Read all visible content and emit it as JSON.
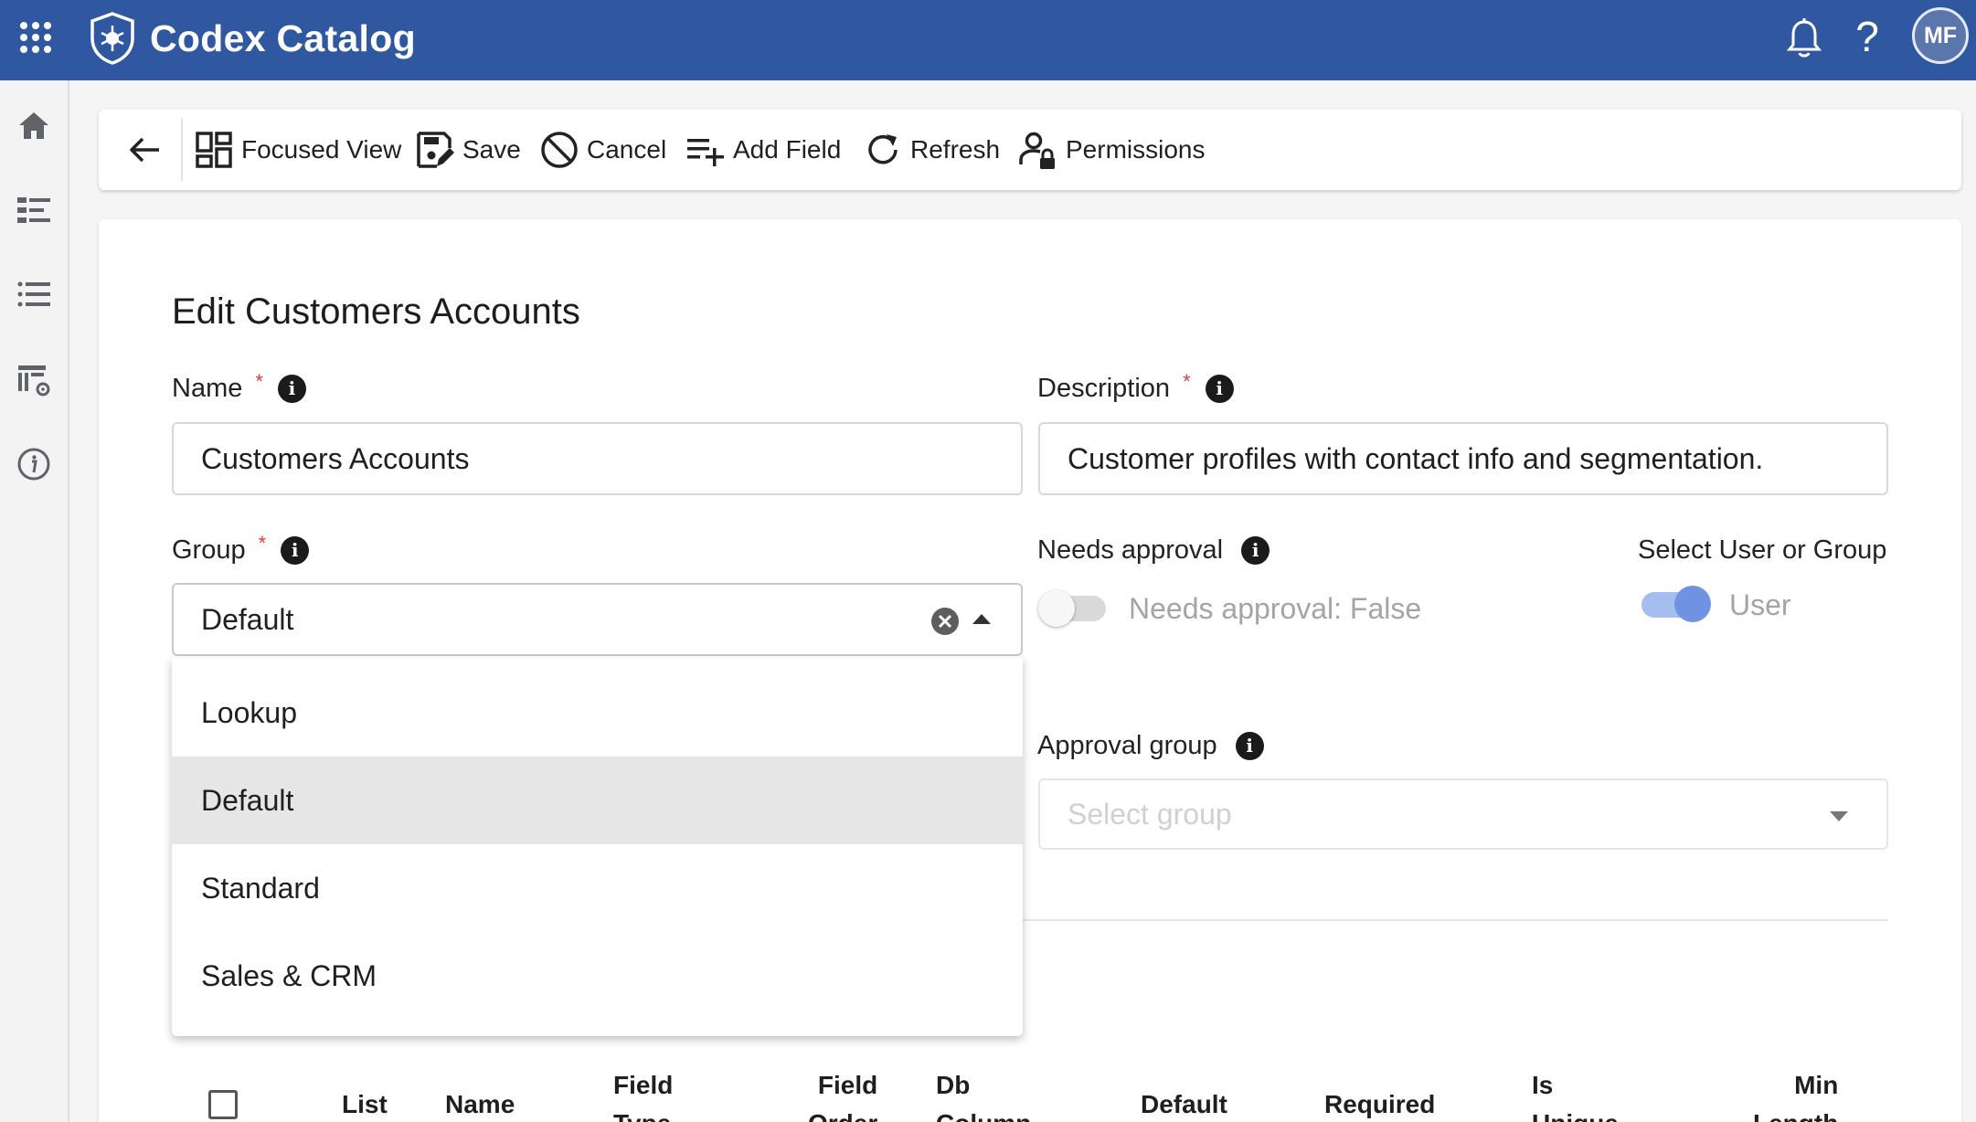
{
  "app": {
    "title": "Codex Catalog",
    "user_initials": "MF",
    "help_label": "?"
  },
  "toolbar": {
    "focused_view": "Focused View",
    "save": "Save",
    "cancel": "Cancel",
    "add_field": "Add Field",
    "refresh": "Refresh",
    "permissions": "Permissions"
  },
  "form": {
    "title": "Edit Customers Accounts",
    "name_label": "Name",
    "name_value": "Customers Accounts",
    "description_label": "Description",
    "description_value": "Customer profiles with contact info and segmentation.",
    "group_label": "Group",
    "group_value": "Default",
    "group_options": [
      "Lookup",
      "Default",
      "Standard",
      "Sales & CRM"
    ],
    "needs_approval_label": "Needs approval",
    "needs_approval_text": "Needs approval: False",
    "select_user_group_label": "Select User or Group",
    "select_user_group_value": "User",
    "approval_group_label": "Approval group",
    "approval_group_placeholder": "Select group",
    "required_mark": "*",
    "info_glyph": "i"
  },
  "table": {
    "headers": {
      "list": "List",
      "name": "Name",
      "field_type_1": "Field",
      "field_type_2": "Type",
      "field_order_1": "Field",
      "field_order_2": "Order",
      "db_column_1": "Db",
      "db_column_2": "Column",
      "default": "Default",
      "required": "Required",
      "is_unique_1": "Is",
      "is_unique_2": "Unique",
      "min_length_1": "Min",
      "min_length_2": "Length"
    }
  },
  "colors": {
    "brand": "#2f58a0",
    "toggle_on": "#6f93e0",
    "toggle_off": "#d9d9d9",
    "required": "#e53935"
  }
}
